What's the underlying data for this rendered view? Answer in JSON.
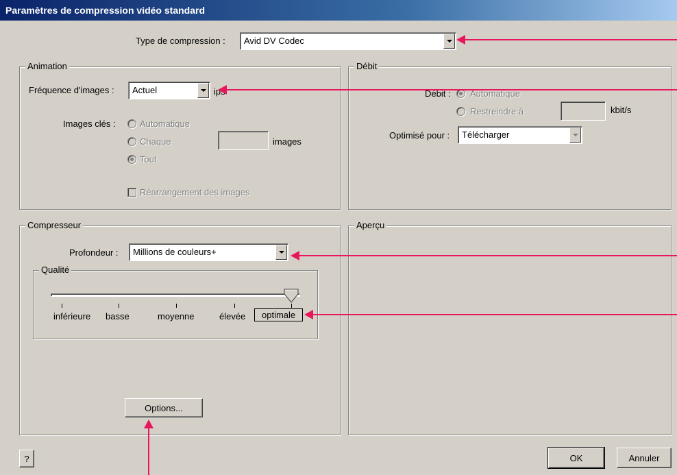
{
  "window": {
    "title": "Paramètres de compression vidéo standard"
  },
  "compression_type": {
    "label": "Type de compression :",
    "value": "Avid DV Codec"
  },
  "animation": {
    "title": "Animation",
    "frame_rate_label": "Fréquence d'images :",
    "frame_rate_value": "Actuel",
    "frame_rate_unit": "ips",
    "keyframes_label": "Images clés :",
    "keyframes_auto": "Automatique",
    "keyframes_every": "Chaque",
    "keyframes_every_unit": "images",
    "keyframes_all": "Tout",
    "reorder_label": "Réarrangement des images"
  },
  "debit": {
    "title": "Débit",
    "label": "Débit :",
    "auto": "Automatique",
    "restrict": "Restreindre à",
    "unit": "kbit/s",
    "optimize_label": "Optimisé pour :",
    "optimize_value": "Télécharger"
  },
  "compressor": {
    "title": "Compresseur",
    "depth_label": "Profondeur :",
    "depth_value": "Millions de couleurs+",
    "quality_title": "Qualité",
    "quality_levels": [
      "inférieure",
      "basse",
      "moyenne",
      "élevée",
      "optimale"
    ],
    "quality_selected": "optimale",
    "options_button": "Options..."
  },
  "preview": {
    "title": "Aperçu"
  },
  "footer": {
    "help_button": "?",
    "ok_button": "OK",
    "cancel_button": "Annuler"
  },
  "colors": {
    "annotation_arrow": "#e8175d",
    "dialog_bg": "#d4d0c8",
    "title_bar": "#0a246a"
  }
}
